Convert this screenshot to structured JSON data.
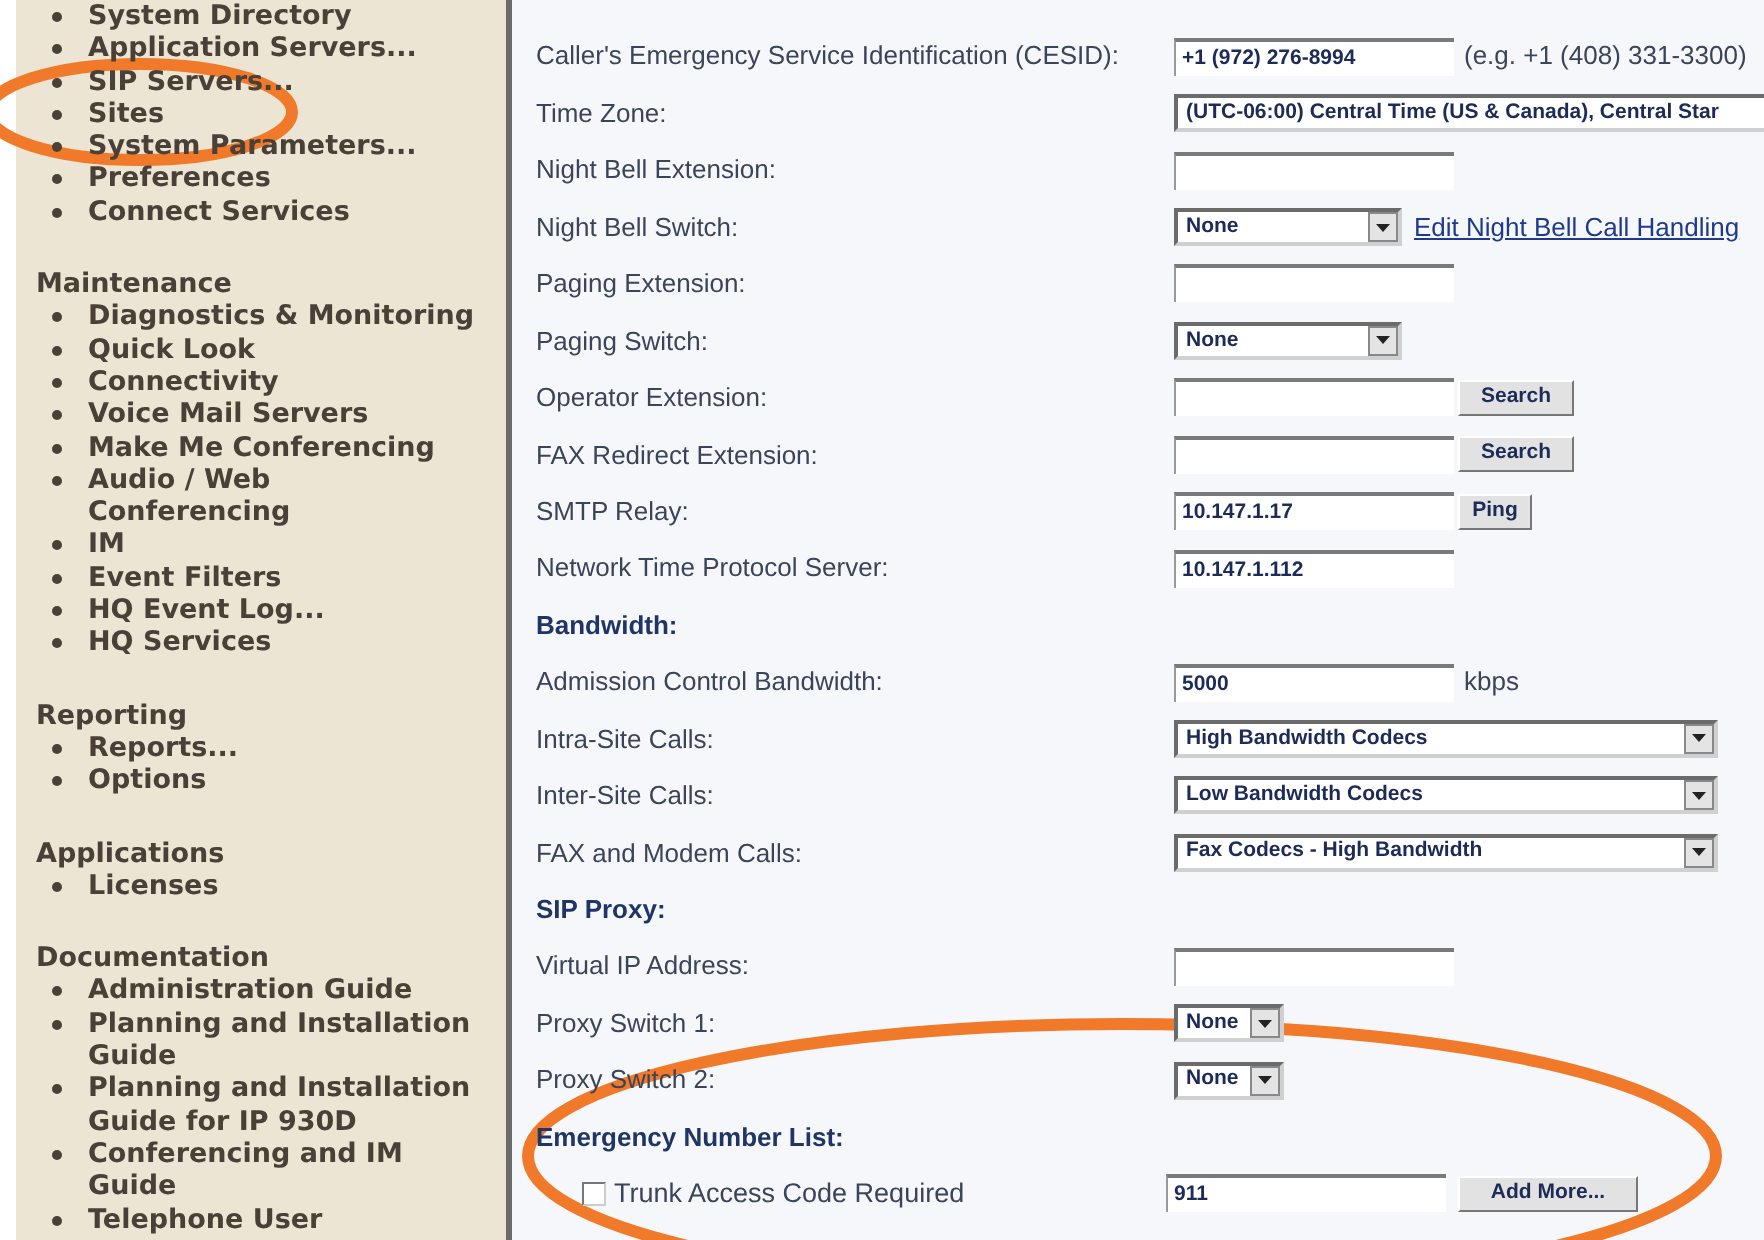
{
  "sidebar": {
    "sections": [
      {
        "items": [
          "System Directory",
          "Application Servers...",
          "SIP Servers...",
          "Sites",
          "System Parameters...",
          "Preferences",
          "Connect Services"
        ]
      },
      {
        "title": "Maintenance",
        "items": [
          "Diagnostics & Monitoring",
          "Quick Look",
          "Connectivity",
          "Voice Mail Servers",
          "Make Me Conferencing",
          "Audio / Web Conferencing",
          "IM",
          "Event Filters",
          "HQ Event Log...",
          "HQ Services"
        ]
      },
      {
        "title": "Reporting",
        "items": [
          "Reports...",
          "Options"
        ]
      },
      {
        "title": "Applications",
        "items": [
          "Licenses"
        ]
      },
      {
        "title": "Documentation",
        "items": [
          "Administration Guide",
          "Planning and Installation Guide",
          "Planning and Installation Guide for IP 930D",
          "Conferencing and IM Guide",
          "Telephone User"
        ]
      }
    ]
  },
  "form": {
    "rows": [
      {
        "kind": "input",
        "label": "Caller's Emergency Service Identification (CESID):",
        "value": "+1 (972) 276-8994",
        "hint": "(e.g. +1 (408) 331-3300)"
      },
      {
        "kind": "full-select",
        "label": "Time Zone:",
        "value": "(UTC-06:00) Central Time (US & Canada), Central Star"
      },
      {
        "kind": "input",
        "label": "Night Bell Extension:"
      },
      {
        "kind": "select",
        "label": "Night Bell Switch:",
        "value": "None",
        "link": "Edit Night Bell Call Handling"
      },
      {
        "kind": "input",
        "label": "Paging Extension:"
      },
      {
        "kind": "select",
        "label": "Paging Switch:",
        "value": "None"
      },
      {
        "kind": "input",
        "label": "Operator Extension:",
        "button": "Search"
      },
      {
        "kind": "input",
        "label": "FAX Redirect Extension:",
        "button": "Search"
      },
      {
        "kind": "input",
        "label": "SMTP Relay:",
        "value": "10.147.1.17",
        "button": "Ping"
      },
      {
        "kind": "input",
        "label": "Network Time Protocol Server:",
        "value": "10.147.1.112"
      },
      {
        "kind": "heading",
        "label": "Bandwidth:"
      },
      {
        "kind": "input",
        "label": "Admission Control Bandwidth:",
        "value": "5000",
        "hint": "kbps"
      },
      {
        "kind": "wide-select",
        "label": "Intra-Site Calls:",
        "value": "High Bandwidth Codecs"
      },
      {
        "kind": "wide-select",
        "label": "Inter-Site Calls:",
        "value": "Low Bandwidth Codecs"
      },
      {
        "kind": "wide-select",
        "label": "FAX and Modem Calls:",
        "value": "Fax Codecs - High Bandwidth"
      },
      {
        "kind": "heading",
        "label": "SIP Proxy:"
      },
      {
        "kind": "input",
        "label": "Virtual IP Address:"
      },
      {
        "kind": "mini-select",
        "label": "Proxy Switch 1:",
        "value": "None"
      },
      {
        "kind": "mini-select",
        "label": "Proxy Switch 2:",
        "value": "None"
      },
      {
        "kind": "heading",
        "label": "Emergency Number List:"
      },
      {
        "kind": "checkbox",
        "label": "Trunk Access Code Required",
        "checked": false,
        "value": "911",
        "button": "Add More..."
      }
    ]
  }
}
